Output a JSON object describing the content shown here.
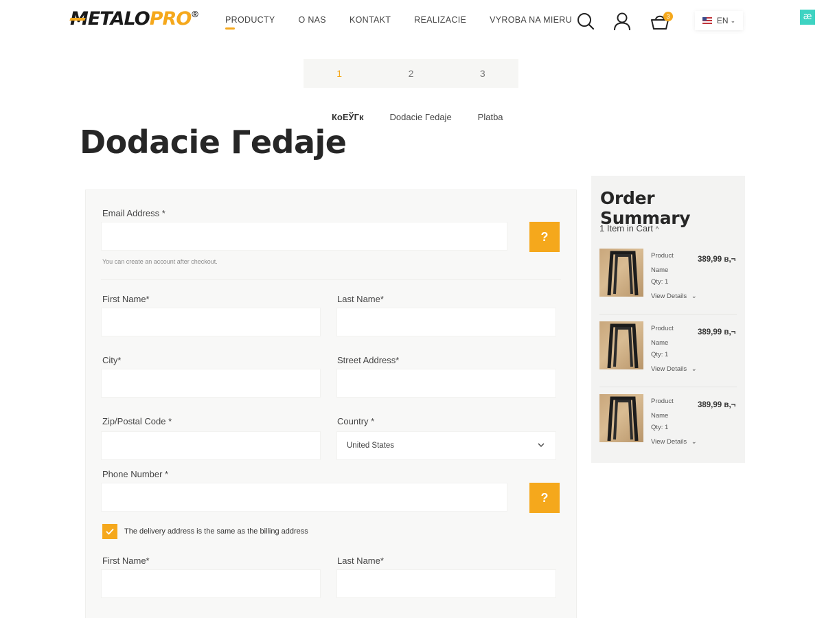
{
  "header": {
    "logo": {
      "metalo": "METALO",
      "pro": "PRO",
      "reg": "®"
    },
    "nav": [
      {
        "label": "PRODUCTY",
        "active": true
      },
      {
        "label": "O NAS"
      },
      {
        "label": "KONTAKT"
      },
      {
        "label": "REALIZACIE"
      },
      {
        "label": "VYROBA NA MIERU"
      }
    ],
    "cart_count": "3",
    "language": "EN",
    "ext_badge": "æ"
  },
  "steps": [
    "1",
    "2",
    "3"
  ],
  "subtabs": [
    "КоЕЎГк",
    "Dodacie Гedaje",
    "Platba"
  ],
  "page_title": "Dodacie Гedaje",
  "form": {
    "email_label": "Email Address *",
    "email_hint": "You can create an account after checkout.",
    "help_label": "?",
    "first_name_label": "First Name*",
    "last_name_label": "Last Name*",
    "city_label": "City*",
    "street_label": "Street Address*",
    "zip_label": "Zip/Postal Code *",
    "country_label": "Country *",
    "country_value": "United States",
    "phone_label": "Phone Number *",
    "same_address_label": "The delivery address is the same as the billing address",
    "delivery_first_name_label": "First Name*",
    "delivery_last_name_label": "Last Name*"
  },
  "summary": {
    "title": "Order Summary",
    "items_toggle": "1 Item in Cart",
    "items": [
      {
        "name": "Product Name",
        "qty": "Qty: 1",
        "details": "View Details",
        "price": "389,99 в,¬"
      },
      {
        "name": "Product Name",
        "qty": "Qty: 1",
        "details": "View Details",
        "price": "389,99 в,¬"
      },
      {
        "name": "Product Name",
        "qty": "Qty: 1",
        "details": "View Details",
        "price": "389,99 в,¬"
      }
    ]
  },
  "colors": {
    "accent": "#f5a81c",
    "panel": "#f8f8f7",
    "summary_bg": "#f3f3f2",
    "text_dark": "#262626"
  },
  "icons": [
    "search-icon",
    "user-icon",
    "cart-icon",
    "flag-icon",
    "chevron-down-icon",
    "chevron-up-icon",
    "check-icon"
  ]
}
